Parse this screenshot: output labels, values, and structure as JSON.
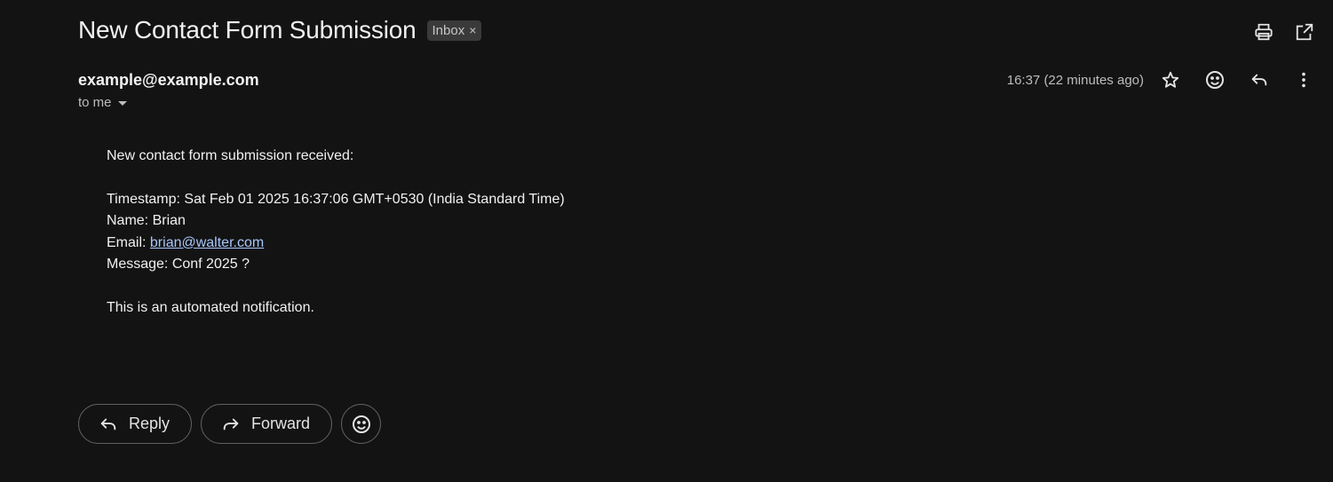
{
  "email": {
    "subject": "New Contact Form Submission",
    "label": "Inbox",
    "label_remove": "×",
    "sender": "example@example.com",
    "recipient": "to me",
    "time": "16:37 (22 minutes ago)"
  },
  "body": {
    "line1": "New contact form submission received:",
    "timestamp_line": "Timestamp: Sat Feb 01 2025 16:37:06 GMT+0530 (India Standard Time)",
    "name_line": "Name: Brian",
    "email_prefix": "Email: ",
    "email_link": "brian@walter.com",
    "message_line": "Message: Conf 2025 ?",
    "footer": "This is an automated notification."
  },
  "actions": {
    "reply": "Reply",
    "forward": "Forward"
  },
  "icons": {
    "print": "print-icon",
    "open_new_window": "open-in-new-icon",
    "star": "star-icon",
    "emoji": "emoji-icon",
    "reply": "reply-icon",
    "more": "more-vert-icon",
    "forward": "forward-icon"
  },
  "colors": {
    "background": "#131313",
    "link": "#a8c7fa",
    "chip": "#3a3a3a"
  }
}
